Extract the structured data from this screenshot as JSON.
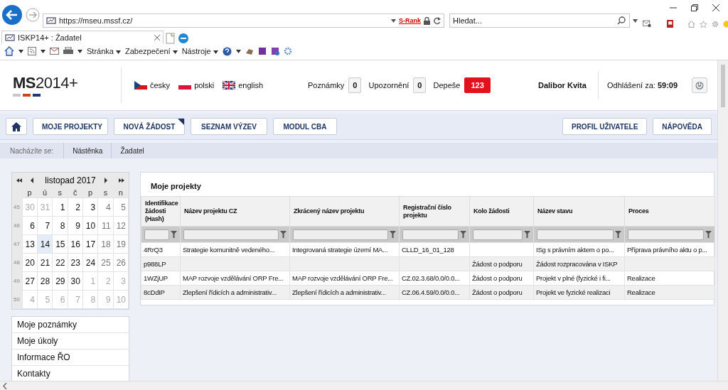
{
  "browser": {
    "url": "https://mseu.mssf.cz/",
    "rank_label": "S-Rank",
    "search_placeholder": "Hledat...",
    "tab_title": "ISKP14+ : Žadatel",
    "menus": [
      "Stránka",
      "Zabezpečení",
      "Nástroje"
    ]
  },
  "header": {
    "logo_bold": "MS",
    "logo_rest": "2014+",
    "languages": [
      {
        "label": "česky",
        "kind": "cz"
      },
      {
        "label": "polski",
        "kind": "pl"
      },
      {
        "label": "english",
        "kind": "gb"
      }
    ],
    "counters": [
      {
        "label": "Poznámky",
        "count": "0",
        "alert": false
      },
      {
        "label": "Upozornění",
        "count": "0",
        "alert": false
      },
      {
        "label": "Depeše",
        "count": "123",
        "alert": true
      }
    ],
    "user": "Dalibor Kvita",
    "logout_label": "Odhlášení za:",
    "logout_time": "59:09"
  },
  "nav": {
    "left": [
      {
        "label": "MOJE PROJEKTY",
        "flagged": false
      },
      {
        "label": "NOVÁ ŽÁDOST",
        "flagged": true
      },
      {
        "label": "SEZNAM VÝZEV",
        "flagged": false
      },
      {
        "label": "MODUL CBA",
        "flagged": false
      }
    ],
    "right": [
      "PROFIL UŽIVATELE",
      "NÁPOVĚDA"
    ]
  },
  "breadcrumb": {
    "label": "Nacházíte se:",
    "items": [
      "Nástěnka",
      "Žadatel"
    ]
  },
  "calendar": {
    "title": "listopad 2017",
    "weekdays": [
      "p",
      "ú",
      "s",
      "č",
      "p",
      "s",
      "n"
    ],
    "weeks": [
      {
        "number": "45",
        "days": [
          {
            "label": "30",
            "kind": "outside",
            "selected": false
          },
          {
            "label": "31",
            "kind": "outside",
            "selected": false
          },
          {
            "label": "1",
            "kind": "normal",
            "selected": false
          },
          {
            "label": "2",
            "kind": "normal",
            "selected": false
          },
          {
            "label": "3",
            "kind": "normal",
            "selected": false
          },
          {
            "label": "4",
            "kind": "weekend",
            "selected": false
          },
          {
            "label": "5",
            "kind": "weekend",
            "selected": false
          }
        ]
      },
      {
        "number": "46",
        "days": [
          {
            "label": "6",
            "kind": "normal",
            "selected": false
          },
          {
            "label": "7",
            "kind": "normal",
            "selected": false
          },
          {
            "label": "8",
            "kind": "normal",
            "selected": false
          },
          {
            "label": "9",
            "kind": "normal",
            "selected": false
          },
          {
            "label": "10",
            "kind": "normal",
            "selected": false
          },
          {
            "label": "11",
            "kind": "weekend",
            "selected": false
          },
          {
            "label": "12",
            "kind": "weekend",
            "selected": false
          }
        ]
      },
      {
        "number": "47",
        "days": [
          {
            "label": "13",
            "kind": "normal",
            "selected": false
          },
          {
            "label": "14",
            "kind": "normal",
            "selected": true
          },
          {
            "label": "15",
            "kind": "normal",
            "selected": false
          },
          {
            "label": "16",
            "kind": "normal",
            "selected": false
          },
          {
            "label": "17",
            "kind": "normal",
            "selected": false
          },
          {
            "label": "18",
            "kind": "weekend",
            "selected": false
          },
          {
            "label": "19",
            "kind": "weekend",
            "selected": false
          }
        ]
      },
      {
        "number": "48",
        "days": [
          {
            "label": "20",
            "kind": "normal",
            "selected": false
          },
          {
            "label": "21",
            "kind": "normal",
            "selected": false
          },
          {
            "label": "22",
            "kind": "normal",
            "selected": false
          },
          {
            "label": "23",
            "kind": "normal",
            "selected": false
          },
          {
            "label": "24",
            "kind": "normal",
            "selected": false
          },
          {
            "label": "25",
            "kind": "weekend",
            "selected": false
          },
          {
            "label": "26",
            "kind": "weekend",
            "selected": false
          }
        ]
      },
      {
        "number": "49",
        "days": [
          {
            "label": "27",
            "kind": "normal",
            "selected": false
          },
          {
            "label": "28",
            "kind": "normal",
            "selected": false
          },
          {
            "label": "29",
            "kind": "normal",
            "selected": false
          },
          {
            "label": "30",
            "kind": "normal",
            "selected": false
          },
          {
            "label": "1",
            "kind": "outside",
            "selected": false
          },
          {
            "label": "2",
            "kind": "outside",
            "selected": false
          },
          {
            "label": "3",
            "kind": "outside",
            "selected": false
          }
        ]
      },
      {
        "number": "50",
        "days": [
          {
            "label": "4",
            "kind": "outside",
            "selected": false
          },
          {
            "label": "5",
            "kind": "outside",
            "selected": false
          },
          {
            "label": "6",
            "kind": "outside",
            "selected": false
          },
          {
            "label": "7",
            "kind": "outside",
            "selected": false
          },
          {
            "label": "8",
            "kind": "outside",
            "selected": false
          },
          {
            "label": "9",
            "kind": "outside",
            "selected": false
          },
          {
            "label": "10",
            "kind": "outside",
            "selected": false
          }
        ]
      }
    ]
  },
  "side_menu": [
    "Moje poznámky",
    "Moje úkoly",
    "Informace ŘO",
    "Kontakty"
  ],
  "projects": {
    "title": "Moje projekty",
    "columns": [
      "Identifikace žádosti (Hash)",
      "Název projektu CZ",
      "Zkrácený název projektu",
      "Registrační číslo projektu",
      "Kolo žádosti",
      "Název stavu",
      "Proces"
    ],
    "rows": [
      [
        "4RrQ3",
        "Strategie komunitně vedeného...",
        "Integrovaná strategie území MA...",
        "CLLD_16_01_128",
        null,
        "ISg s právním aktem o po...",
        "Příprava právního aktu o p..."
      ],
      [
        "p988LP",
        null,
        null,
        null,
        "Žádost o podporu",
        "Žádost rozpracována v ISKP",
        null
      ],
      [
        "1WZjUP",
        "MAP rozvoje vzdělávání ORP Fre...",
        "MAP rozvoje vzdělávání ORP Fre...",
        "CZ.02.3.68/0.0/0.0...",
        "Žádost o podporu",
        "Projekt v plné (fyzické i fi...",
        "Realizace"
      ],
      [
        "8cDdIP",
        "Zlepšení řídicích a administrativ...",
        "Zlepšení řídicích a administrativ...",
        "CZ.06.4.59/0.0/0.0...",
        "Žádost o podporu",
        "Projekt ve fyzické realizaci",
        "Realizace"
      ]
    ]
  }
}
